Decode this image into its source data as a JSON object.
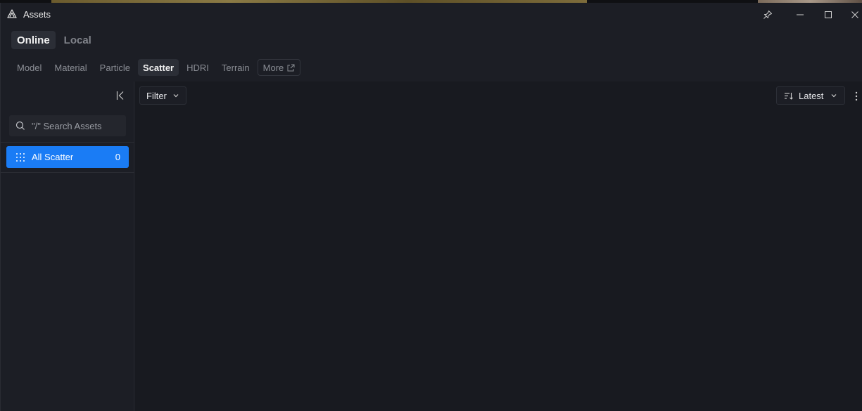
{
  "window": {
    "title": "Assets",
    "icons": {
      "app": "app-logo-icon",
      "pin": "pin-icon",
      "minimize": "minimize-icon",
      "maximize": "maximize-icon",
      "close": "close-icon"
    }
  },
  "source_tabs": [
    {
      "label": "Online",
      "active": true
    },
    {
      "label": "Local",
      "active": false
    }
  ],
  "type_tabs": [
    {
      "label": "Model",
      "active": false
    },
    {
      "label": "Material",
      "active": false
    },
    {
      "label": "Particle",
      "active": false
    },
    {
      "label": "Scatter",
      "active": true
    },
    {
      "label": "HDRI",
      "active": false
    },
    {
      "label": "Terrain",
      "active": false
    }
  ],
  "more_tab": {
    "label": "More",
    "icon": "external-link-icon"
  },
  "sidebar": {
    "collapse_icon": "collapse-left-icon",
    "search": {
      "placeholder": "\"/\" Search Assets",
      "value": "",
      "icon": "search-icon"
    },
    "categories": [
      {
        "label": "All Scatter",
        "count": "0",
        "selected": true,
        "icon": "grid-dots-icon"
      }
    ]
  },
  "toolbar": {
    "filter_label": "Filter",
    "sort_label": "Latest",
    "sort_icon": "sort-icon",
    "more_icon": "kebab-menu-icon"
  },
  "colors": {
    "accent": "#1a7cf5",
    "window_bg": "#1c1e25",
    "content_bg": "#181a20"
  }
}
